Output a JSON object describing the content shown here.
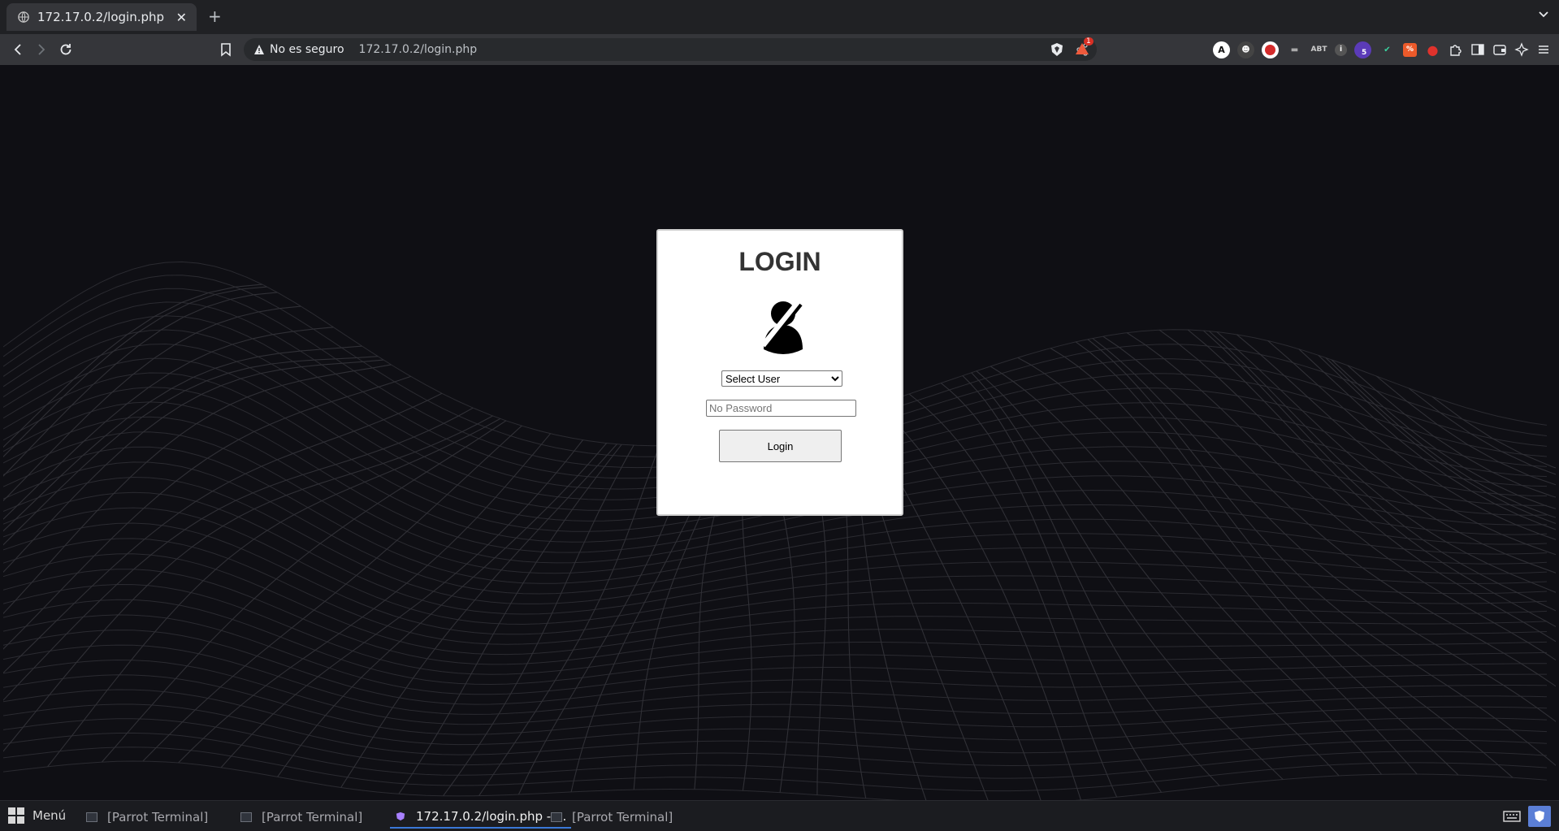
{
  "browser": {
    "tab_title": "172.17.0.2/login.php",
    "new_tab_label": "+",
    "security_label": "No es seguro",
    "url": "172.17.0.2/login.php",
    "shields_badge": "1",
    "extension_badge": "5"
  },
  "login": {
    "title": "LOGIN",
    "select_selected": "Select User",
    "password_placeholder": "No Password",
    "button_label": "Login"
  },
  "taskbar": {
    "menu_label": "Menú",
    "tasks": [
      {
        "label": "[Parrot Terminal]"
      },
      {
        "label": "[Parrot Terminal]"
      },
      {
        "label": "172.17.0.2/login.php - ..."
      },
      {
        "label": "[Parrot Terminal]"
      }
    ]
  },
  "colors": {
    "page_background": "#0f0f14",
    "card_background": "#ffffff",
    "title_color": "#333333",
    "browser_chrome": "#35363a"
  }
}
